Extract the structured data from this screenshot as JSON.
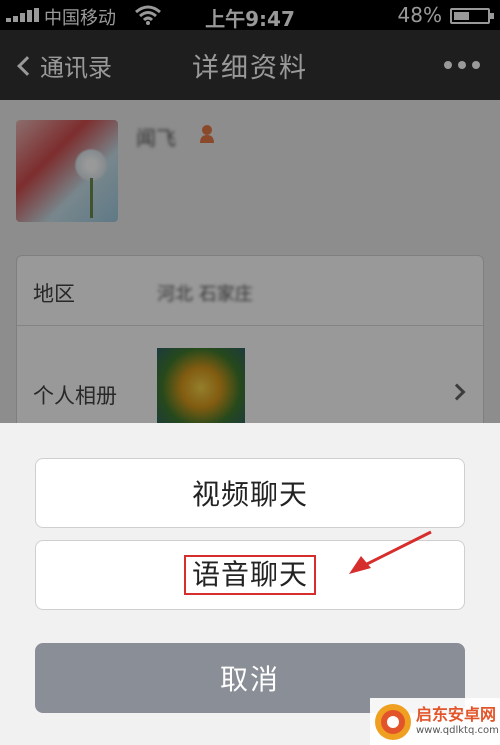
{
  "status_bar": {
    "carrier": "中国移动",
    "time": "上午9:47",
    "battery_percent": "48%",
    "battery_level": 0.48
  },
  "nav": {
    "back_label": "通讯录",
    "title": "详细资料",
    "more_icon": "more-dots-icon"
  },
  "profile": {
    "name": "闻飞",
    "gender_icon": "female-gender-icon"
  },
  "info": {
    "region_label": "地区",
    "region_value": "河北 石家庄",
    "album_label": "个人相册"
  },
  "action_sheet": {
    "video_call": "视频聊天",
    "voice_call": "语音聊天",
    "cancel": "取消"
  },
  "annotation": {
    "highlight_color": "#d62d2d"
  },
  "watermark": {
    "name": "启东安卓网",
    "url": "www.qdlktq.com"
  }
}
